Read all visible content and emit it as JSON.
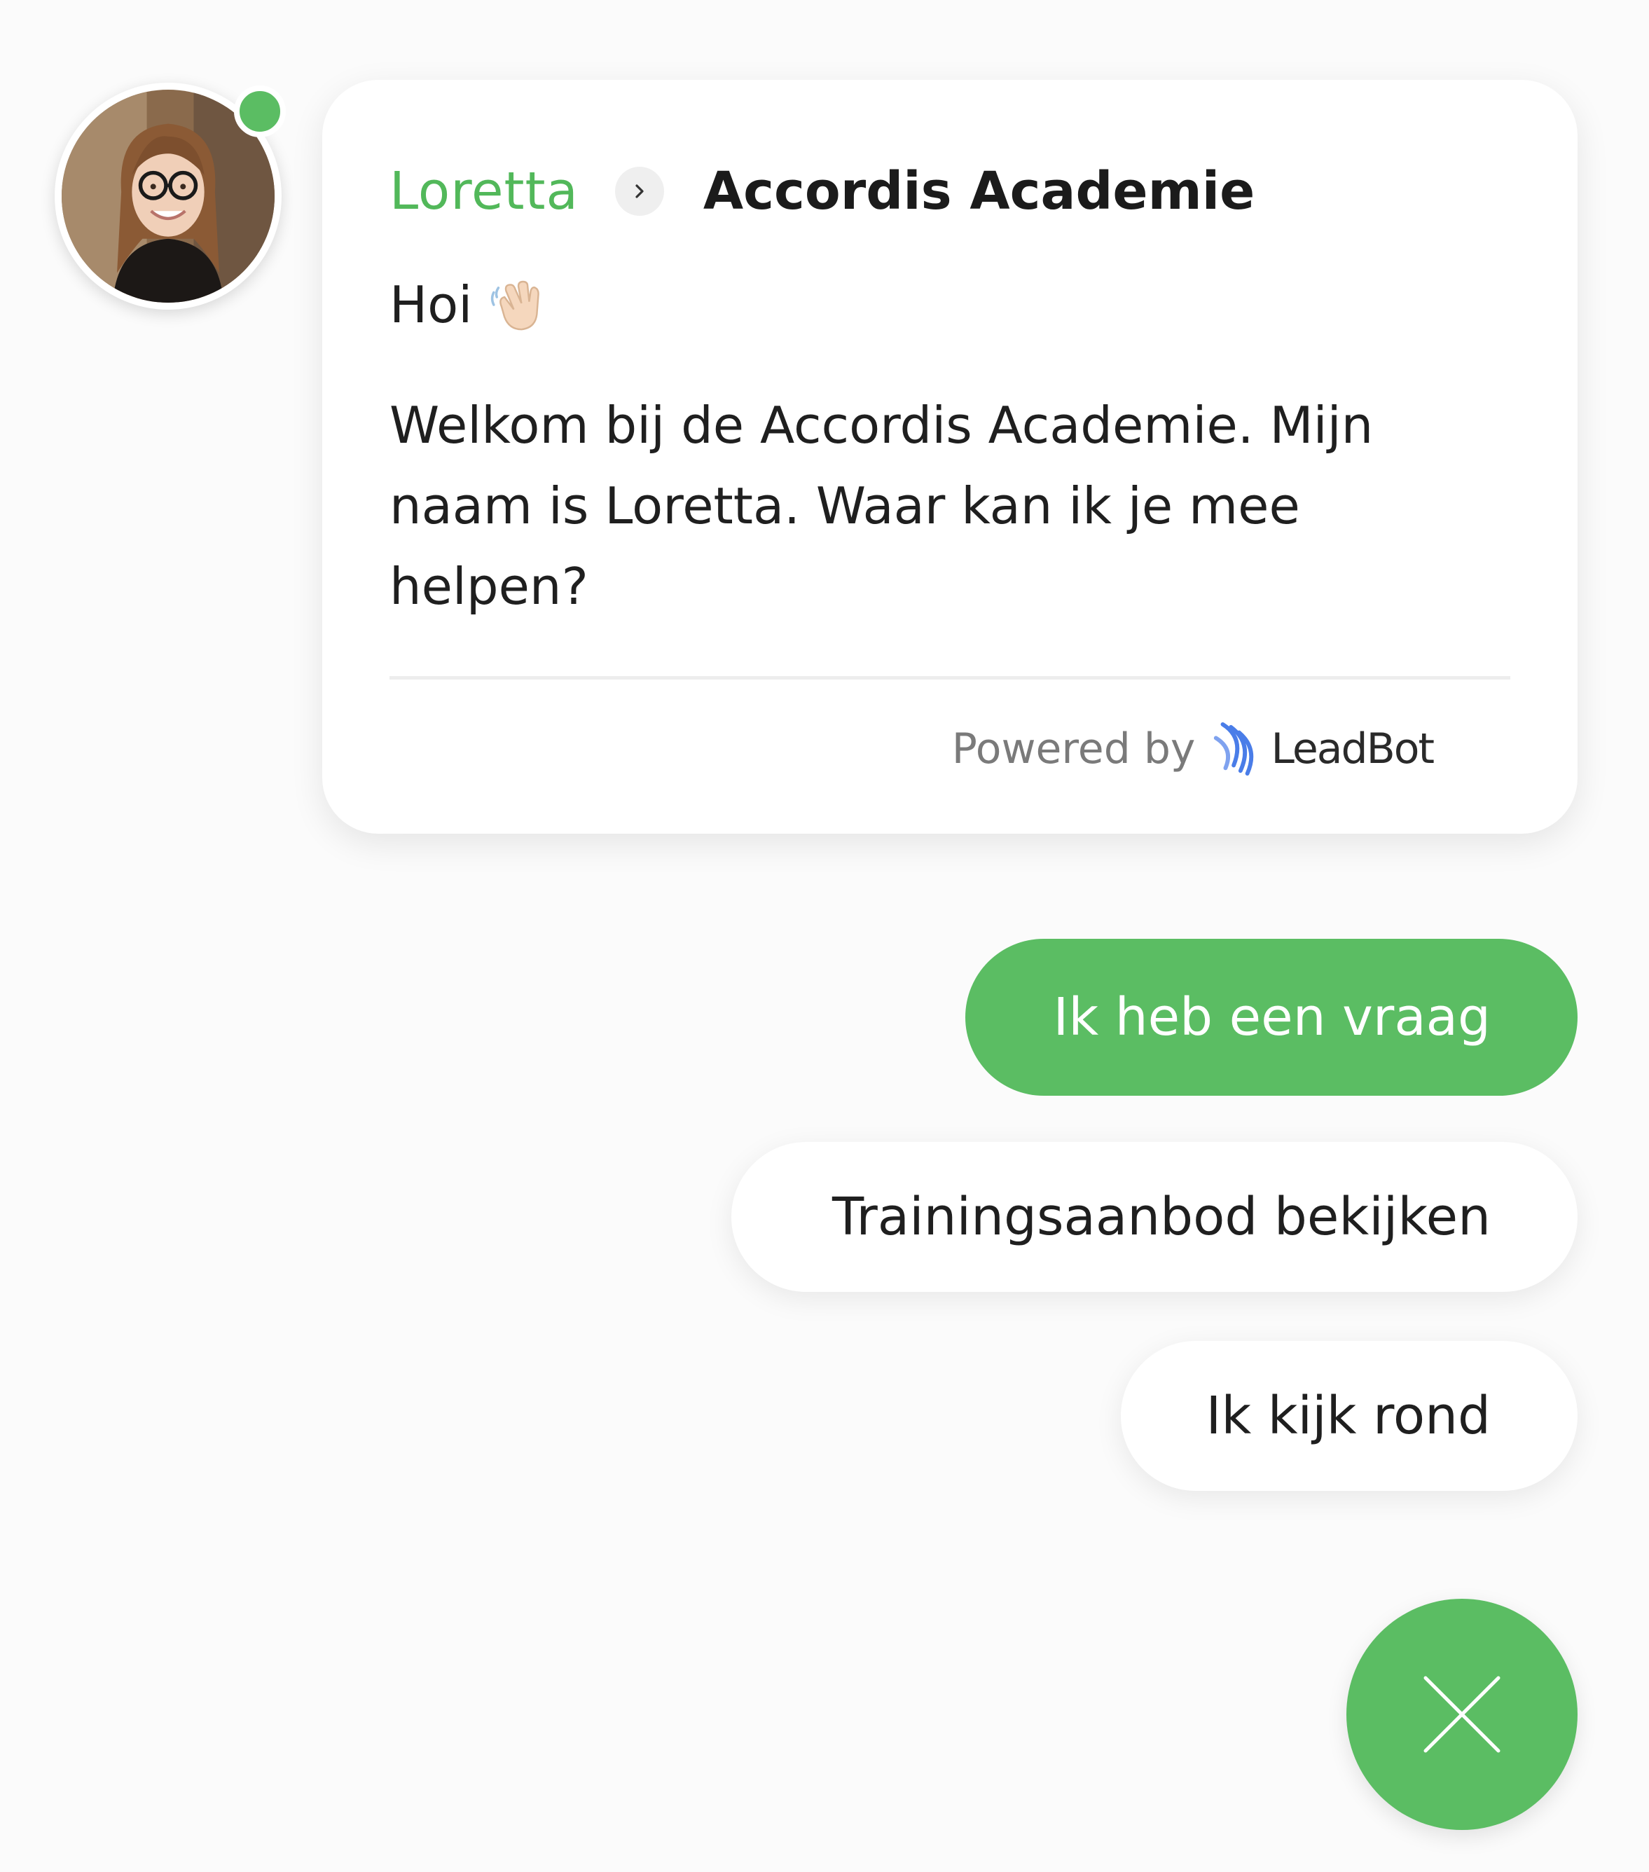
{
  "agent": {
    "name": "Loretta",
    "online": true
  },
  "company": {
    "name": "Accordis Academie"
  },
  "message": {
    "greeting": "Hoi",
    "greeting_emoji": "waving-hand-icon",
    "body": "Welkom bij de Accordis Academie. Mijn naam is Loretta. Waar kan ik je mee helpen?"
  },
  "footer": {
    "powered_by": "Powered by",
    "brand": "LeadBot"
  },
  "quick_replies": [
    {
      "label": "Ik heb een vraag",
      "primary": true
    },
    {
      "label": "Trainingsaanbod bekijken",
      "primary": false
    },
    {
      "label": "Ik kijk rond",
      "primary": false
    }
  ],
  "icons": {
    "header_separator": "chevron-right-icon",
    "close": "close-icon",
    "brand_logo": "leadbot-logo-icon"
  },
  "colors": {
    "accent": "#5bbd63",
    "text": "#1f1f1f",
    "muted": "#7a7a7a",
    "background": "#fbfbfb",
    "card": "#ffffff"
  }
}
